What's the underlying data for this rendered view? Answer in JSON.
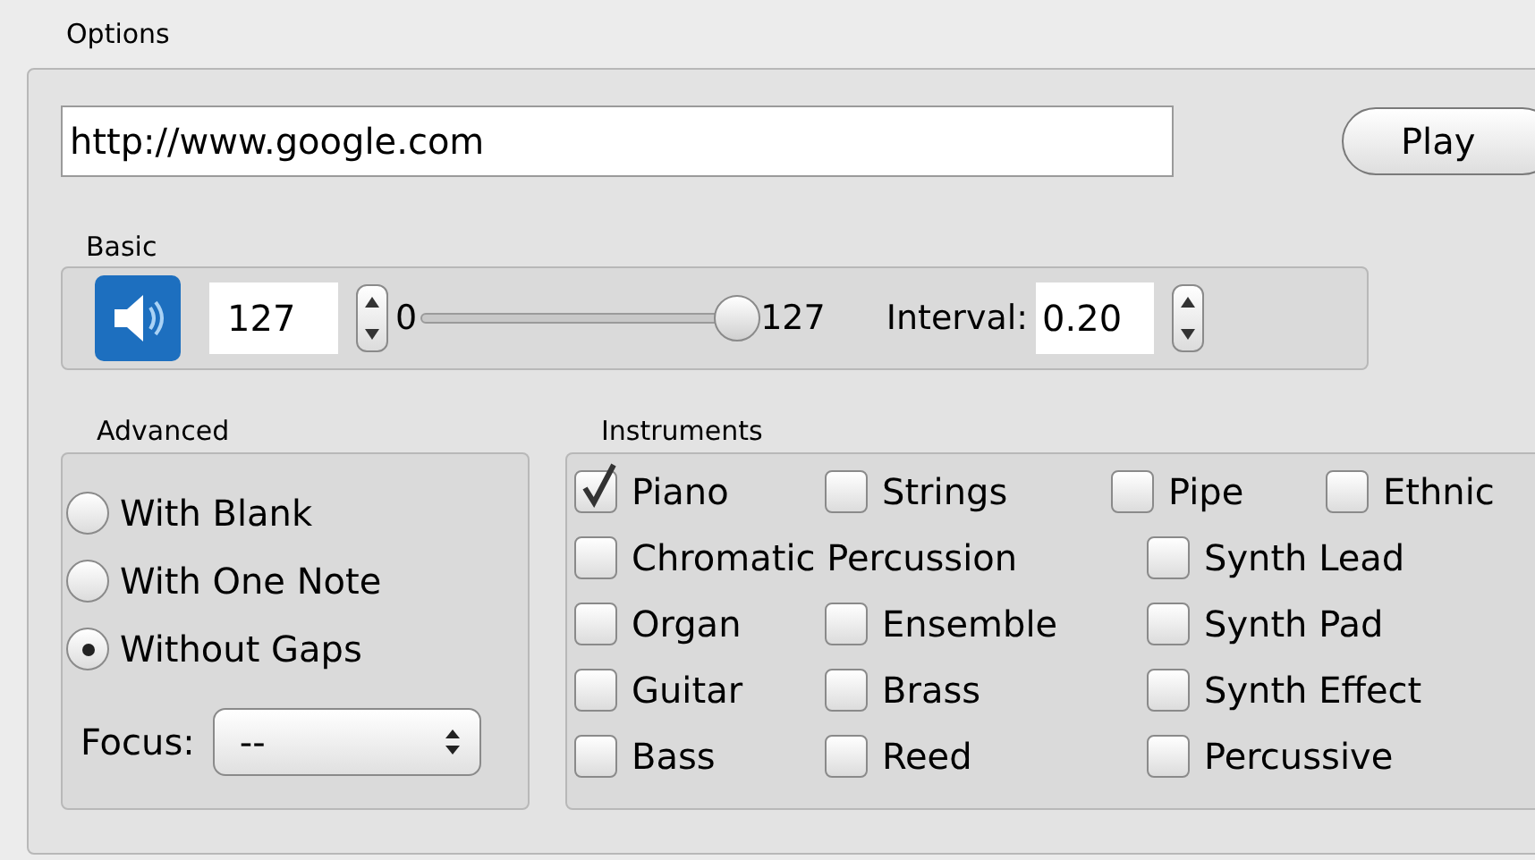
{
  "options": {
    "title": "Options",
    "url": {
      "value": "http://www.google.com"
    },
    "play_button": "Play",
    "basic": {
      "title": "Basic",
      "volume": "127",
      "slider_min": "0",
      "slider_max": "127",
      "slider": {
        "level": 1
      },
      "interval_label": "Interval:",
      "interval": "0.20"
    },
    "advanced": {
      "title": "Advanced",
      "modes": [
        {
          "label": "With Blank",
          "selected": false
        },
        {
          "label": "With One Note",
          "selected": false
        },
        {
          "label": "Without Gaps",
          "selected": true
        }
      ],
      "focus_label": "Focus:",
      "focus_value": "--"
    },
    "instruments": {
      "title": "Instruments",
      "items": [
        {
          "label": "Piano",
          "checked": true
        },
        {
          "label": "Strings",
          "checked": false
        },
        {
          "label": "Pipe",
          "checked": false
        },
        {
          "label": "Ethnic",
          "checked": false
        },
        {
          "label": "Chromatic Percussion",
          "checked": false
        },
        {
          "label": "Synth Lead",
          "checked": false
        },
        {
          "label": "Organ",
          "checked": false
        },
        {
          "label": "Ensemble",
          "checked": false
        },
        {
          "label": "Synth Pad",
          "checked": false
        },
        {
          "label": "Guitar",
          "checked": false
        },
        {
          "label": "Brass",
          "checked": false
        },
        {
          "label": "Synth Effect",
          "checked": false
        },
        {
          "label": "Bass",
          "checked": false
        },
        {
          "label": "Reed",
          "checked": false
        },
        {
          "label": "Percussive",
          "checked": false
        }
      ]
    }
  }
}
